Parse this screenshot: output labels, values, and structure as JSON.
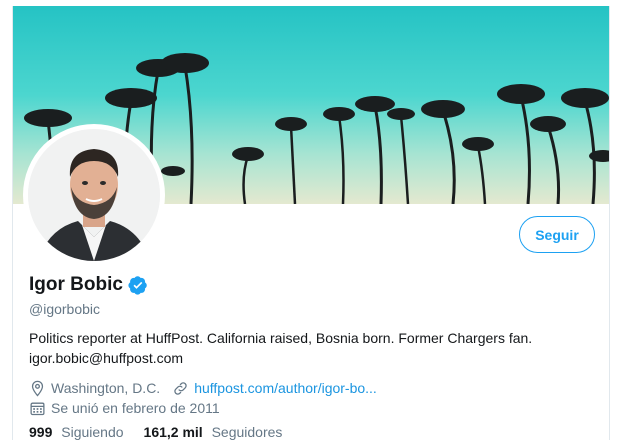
{
  "profile": {
    "name": "Igor Bobic",
    "handle": "@igorbobic",
    "bio_line1": "Politics reporter at HuffPost. California raised, Bosnia born. Former Chargers fan.",
    "bio_line2": "igor.bobic@huffpost.com",
    "location": "Washington, D.C.",
    "website": "huffpost.com/author/igor-bo...",
    "joined": "Se unió en febrero de 2011",
    "following_count": "999",
    "following_label": "Siguiendo",
    "followers_count": "161,2 mil",
    "followers_label": "Seguidores"
  },
  "actions": {
    "follow_label": "Seguir"
  },
  "icons": {
    "verified": "verified-badge-icon",
    "location": "location-pin-icon",
    "link": "link-icon",
    "calendar": "calendar-icon"
  },
  "colors": {
    "accent": "#1da1f2",
    "link": "#1b95e0",
    "secondary_text": "#657786"
  }
}
